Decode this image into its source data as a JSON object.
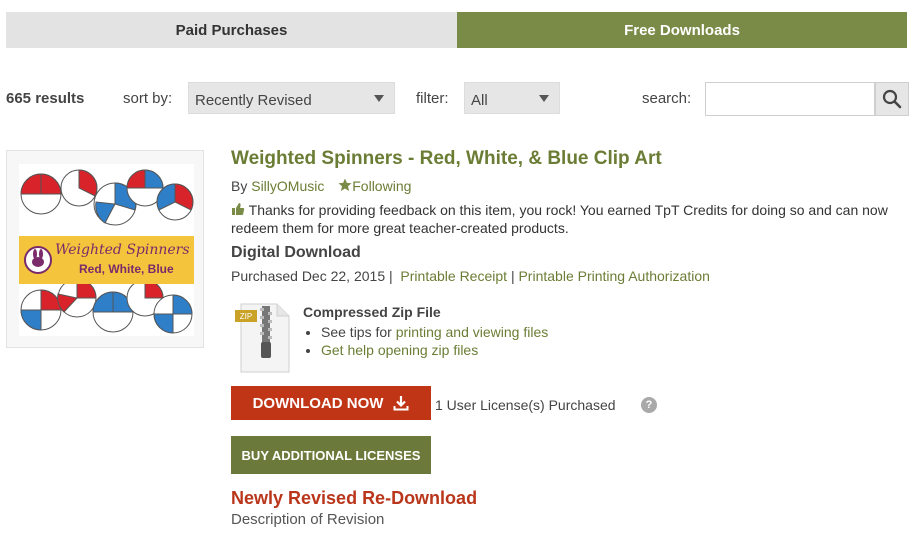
{
  "tabs": {
    "paid": "Paid Purchases",
    "free": "Free Downloads"
  },
  "controls": {
    "results": "665 results",
    "sort_label": "sort by:",
    "sort_value": "Recently Revised",
    "filter_label": "filter:",
    "filter_value": "All",
    "search_label": "search:",
    "search_value": ""
  },
  "product": {
    "thumbnail": {
      "title": "Weighted Spinners",
      "subtitle": "Red, White, Blue"
    },
    "title": "Weighted Spinners - Red, White, & Blue Clip Art",
    "by": "By",
    "author": "SillyOMusic",
    "following": "Following",
    "thanks": "Thanks for providing feedback on this item, you rock! You earned TpT Credits for doing so and can now redeem them for more great teacher-created products.",
    "format": "Digital Download",
    "purchased": "Purchased Dec 22, 2015",
    "sep1": "|",
    "receipt": "Printable Receipt",
    "sep2": "|",
    "authorization": "Printable Printing Authorization",
    "zip": {
      "label": "ZIP",
      "title": "Compressed Zip File",
      "tip1_prefix": "See tips for",
      "tip1_link": "printing and viewing files",
      "tip2_link": "Get help opening zip files"
    },
    "download": "DOWNLOAD NOW",
    "license": "1 User License(s) Purchased",
    "help": "?",
    "buy": "BUY ADDITIONAL LICENSES",
    "revised": "Newly Revised Re-Download",
    "revision_desc": "Description of Revision"
  },
  "colors": {
    "brand_green": "#6b7d35",
    "tab_green": "#7a8a47",
    "download_red": "#c03516",
    "revised_red": "#b9361b"
  }
}
